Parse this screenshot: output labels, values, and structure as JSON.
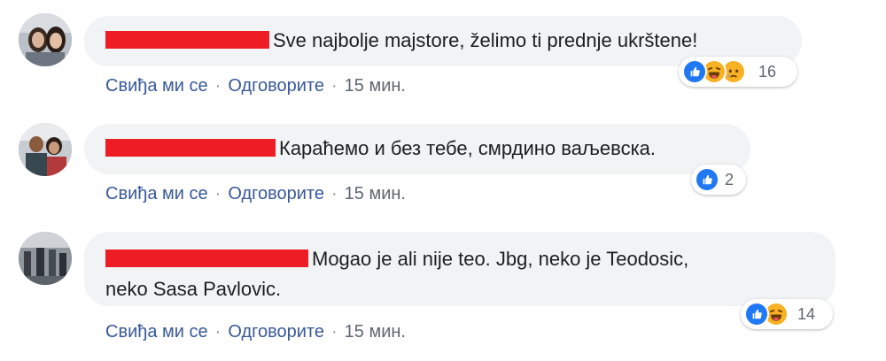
{
  "comments": [
    {
      "text": "Sve najbolje majstore, želimo ti prednje ukrštene!",
      "actions": {
        "like": "Свиђа ми се",
        "reply": "Одговорите",
        "time": "15 мин."
      },
      "reaction_icons": [
        "like-icon",
        "haha-icon",
        "sad-icon"
      ],
      "reaction_count": "16"
    },
    {
      "text": "Караћемо и без тебе, смрдино ваљевска.",
      "actions": {
        "like": "Свиђа ми се",
        "reply": "Одговорите",
        "time": "15 мин."
      },
      "reaction_icons": [
        "like-icon"
      ],
      "reaction_count": "2"
    },
    {
      "text_line1": "Mogao je ali nije teo. Jbg, neko je Teodosic,",
      "text_line2": "neko Sasa Pavlovic.",
      "actions": {
        "like": "Свиђа ми се",
        "reply": "Одговорите",
        "time": "15 мин."
      },
      "reaction_icons": [
        "like-icon",
        "haha-icon"
      ],
      "reaction_count": "14"
    }
  ],
  "separator": "·",
  "colors": {
    "redaction": "#ee1c25",
    "bubble": "#f2f3f5",
    "link": "#385898",
    "like": "#2078f4",
    "emoji": "#f7b125"
  }
}
